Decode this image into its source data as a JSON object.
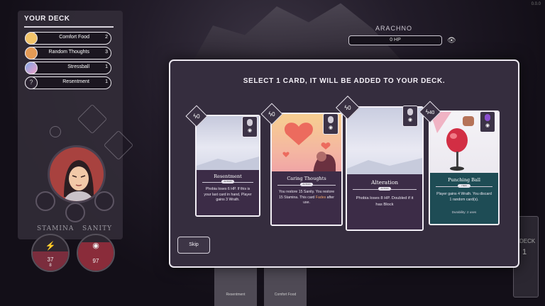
{
  "deck": {
    "title": "YOUR DECK",
    "items": [
      {
        "label": "Comfort Food",
        "count": "2",
        "thumb_color": "#f2c46a"
      },
      {
        "label": "Random Thoughts",
        "count": "3",
        "thumb_color": "#e39a55"
      },
      {
        "label": "Stressball",
        "count": "1",
        "thumb_color": "#7fa7e6"
      },
      {
        "label": "Resentment",
        "count": "1",
        "thumb_color": "#2a2230"
      }
    ]
  },
  "enemy": {
    "name": "ARACHNO",
    "hp": "0 HP"
  },
  "stats": {
    "stamina_label": "STAMINA",
    "sanity_label": "SANITY",
    "stamina_value": "37",
    "stamina_sub": "8",
    "sanity_value": "97"
  },
  "modal": {
    "title": "SELECT 1 CARD, IT WILL BE ADDED TO YOUR DECK.",
    "skip_label": "Skip"
  },
  "cards": [
    {
      "name": "Resentment",
      "cost": "0",
      "pill": "ACTION",
      "description": "Phobia loses 6 HP. If this is your last card in hand, Player gains 3 Wrath.",
      "highlight": "",
      "extra": ""
    },
    {
      "name": "Caring Thoughts",
      "cost": "0",
      "pill": "ACTION",
      "description": "You restore 15 Sanity. You restore 15 Stamina. This card",
      "highlight": "Fades",
      "description_after": "after use.",
      "extra": ""
    },
    {
      "name": "Alteration",
      "cost": "0",
      "pill": "ACTION",
      "description": "Phobia loses 8 HP. Doubled if it has Block",
      "highlight": "",
      "extra": ""
    },
    {
      "name": "Punching Ball",
      "cost": "40",
      "pill": "ITEM",
      "description": "Player gains 4 Wrath. You discard 1 random card(s).",
      "highlight": "",
      "extra": "Durability: 2 uses"
    }
  ],
  "right_panel": {
    "label": "DECK",
    "value": "1"
  },
  "bottom_cards": [
    "Resentment",
    "Comfort Food"
  ],
  "corner": "0.0.0",
  "icons": {
    "cost": "lightning-bolt-icon",
    "eye": "eye-icon",
    "gem": "sanity-gem-icon"
  }
}
